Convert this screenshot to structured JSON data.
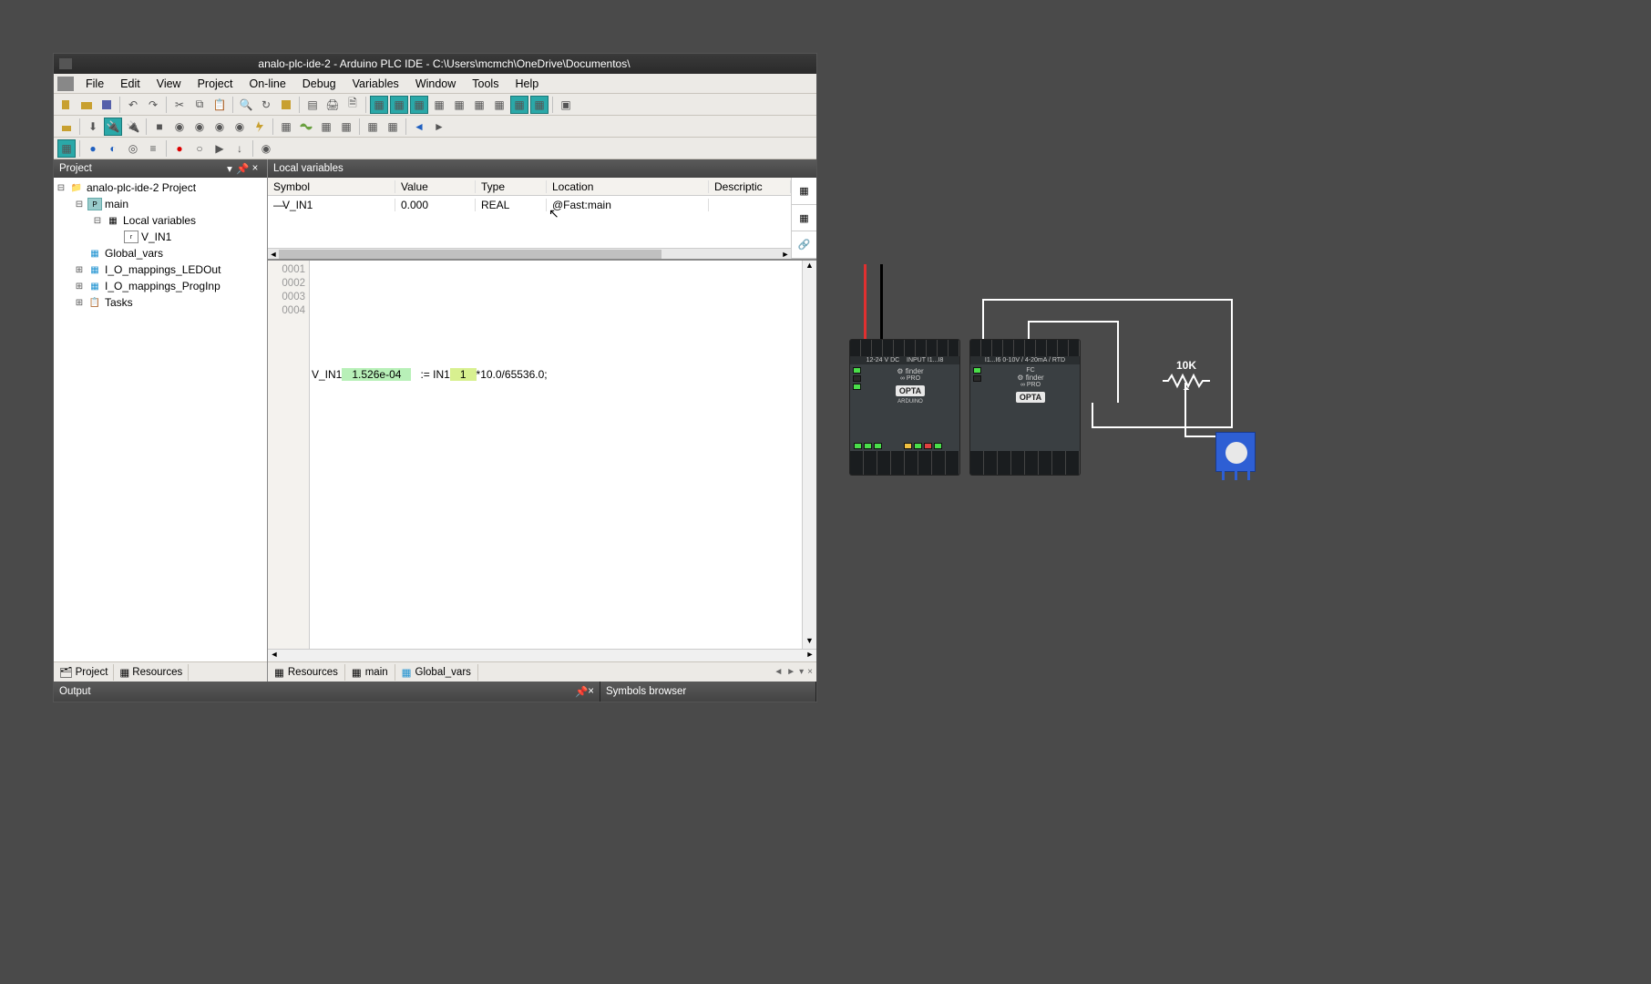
{
  "title": "analo-plc-ide-2 - Arduino PLC IDE - C:\\Users\\mcmch\\OneDrive\\Documentos\\",
  "menu": [
    "File",
    "Edit",
    "View",
    "Project",
    "On-line",
    "Debug",
    "Variables",
    "Window",
    "Tools",
    "Help"
  ],
  "project_panel": {
    "title": "Project",
    "tree": {
      "root": "analo-plc-ide-2 Project",
      "main": "main",
      "local_vars": "Local variables",
      "v_in1": "V_IN1",
      "global": "Global_vars",
      "io_led": "I_O_mappings_LEDOut",
      "io_prog": "I_O_mappings_ProgInp",
      "tasks": "Tasks"
    },
    "tabs": {
      "project": "Project",
      "resources": "Resources"
    }
  },
  "locals": {
    "title": "Local variables",
    "cols": {
      "symbol": "Symbol",
      "value": "Value",
      "type": "Type",
      "location": "Location",
      "desc": "Descriptic"
    },
    "row": {
      "symbol": "V_IN1",
      "value": "0.000",
      "type": "REAL",
      "location": "@Fast:main"
    }
  },
  "code": {
    "lines": [
      "0001",
      "0002",
      "0003",
      "0004"
    ],
    "l3_var": "V_IN1",
    "l3_val": "1.526e-04",
    "l3_assign": ":= IN1",
    "l3_one": "1",
    "l3_tail": "*10.0/65536.0;"
  },
  "editor_tabs": {
    "resources": "Resources",
    "main": "main",
    "global": "Global_vars"
  },
  "bottom": {
    "output": "Output",
    "symbols": "Symbols browser"
  },
  "hw": {
    "resistor": "10K",
    "brand": "finder",
    "model": "OPTA"
  }
}
